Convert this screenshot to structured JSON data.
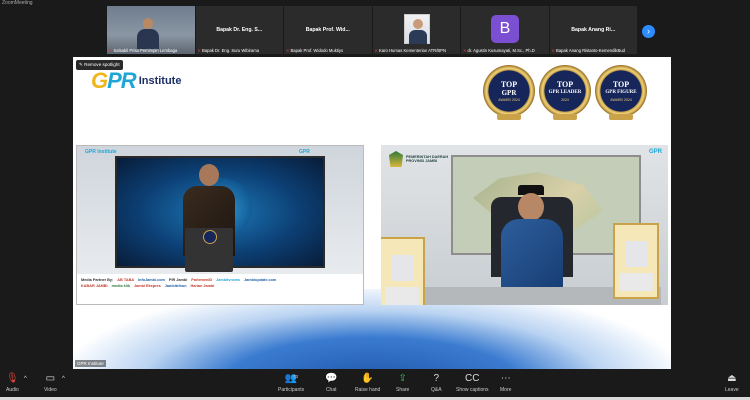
{
  "window": {
    "title": "ZoomMeeting"
  },
  "strip": {
    "tiles": [
      {
        "kind": "video",
        "caption": "Salsabil Prisa Pemimpin Lembaga"
      },
      {
        "kind": "name",
        "name": "Bapak Dr. Eng. S...",
        "caption": "Bapak Dr. Eng. Suru Wibirama"
      },
      {
        "kind": "name",
        "name": "Bapak Prof. Wid...",
        "caption": "Bapak Prof. Widodo Muktiyo"
      },
      {
        "kind": "photo",
        "caption": "Karo Humas Kementerian ATR/BPN"
      },
      {
        "kind": "letter",
        "letter": "B",
        "caption": "dr. Agustin Kusumayati, M.Sc., Ph.D"
      },
      {
        "kind": "name",
        "name": "Bapak Anang Ri...",
        "caption": "Bapak Anang Ristanto-KemendikBud"
      }
    ],
    "next_icon": "chevron-right-icon"
  },
  "stage": {
    "spotlight_label": "Remove spotlight",
    "brand_g": "G",
    "brand_pr": "PR",
    "brand_institute": "Institute",
    "badges": [
      {
        "line1": "TOP",
        "line2": "GPR",
        "line3": "AWARD 2024"
      },
      {
        "line1": "TOP",
        "line2": "GPR LEADER",
        "line3": "2024"
      },
      {
        "line1": "TOP",
        "line2": "GPR FIGURE",
        "line3": "AWARD 2024"
      }
    ],
    "left_video": {
      "corner_logo": "GPR Institute",
      "corner_logo_right": "GPR",
      "media_partner": "Media Partner By:",
      "sponsors_row1": [
        "AB TABA",
        "InfoJambi.com",
        "PIR Jambi",
        "ParlemenID",
        "Jambitvnews",
        "Jambiupdate.com"
      ],
      "sponsors_row2": [
        "KABAR JAMBI",
        "",
        "media klik",
        "Jambi Ekspres",
        "",
        "Jambitribun",
        "Harian Jambi"
      ]
    },
    "right_video": {
      "province_line1": "PEMERINTAH DAERAH",
      "province_line2": "PROVINSI JAMBI",
      "corner_logo": "GPR"
    },
    "caption": "GPR Institute"
  },
  "toolbar": {
    "audio": "Audio",
    "video": "Video",
    "participants": "Participants",
    "participants_count": "73",
    "chat": "Chat",
    "raise_hand": "Raise hand",
    "share": "Share",
    "qa": "Q&A",
    "captions": "Show captions",
    "more": "More",
    "leave": "Leave"
  }
}
